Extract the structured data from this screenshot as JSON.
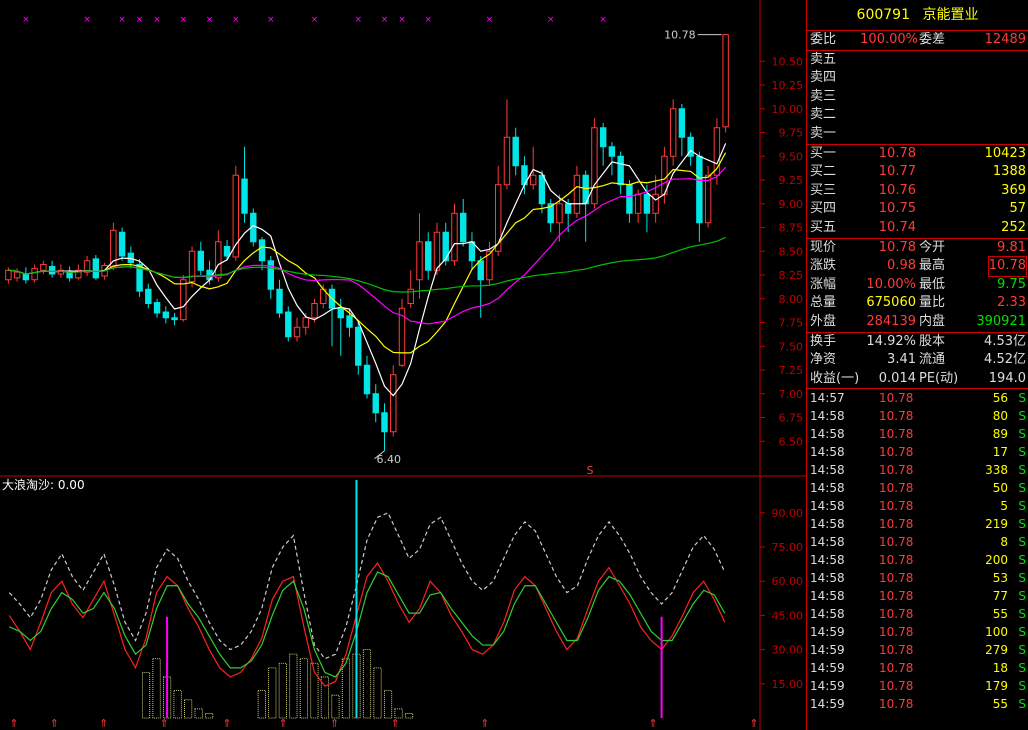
{
  "stock": {
    "code": "600791",
    "name": "京能置业"
  },
  "colors": {
    "up": "#ff3a3a",
    "down": "#00e5e5",
    "ma5": "#ffffff",
    "ma10": "#ffff00",
    "ma20": "#ff00ff",
    "ma60": "#00c000",
    "grid": "#c00000"
  },
  "order_book": {
    "ratio_label": "委比",
    "ratio_value": "100.00%",
    "diff_label": "委差",
    "diff_value": "12489",
    "asks": [
      {
        "label": "卖五",
        "price": "",
        "vol": ""
      },
      {
        "label": "卖四",
        "price": "",
        "vol": ""
      },
      {
        "label": "卖三",
        "price": "",
        "vol": ""
      },
      {
        "label": "卖二",
        "price": "",
        "vol": ""
      },
      {
        "label": "卖一",
        "price": "",
        "vol": ""
      }
    ],
    "bids": [
      {
        "label": "买一",
        "price": "10.78",
        "vol": "10423"
      },
      {
        "label": "买二",
        "price": "10.77",
        "vol": "1388"
      },
      {
        "label": "买三",
        "price": "10.76",
        "vol": "369"
      },
      {
        "label": "买四",
        "price": "10.75",
        "vol": "57"
      },
      {
        "label": "买五",
        "price": "10.74",
        "vol": "252"
      }
    ]
  },
  "quote": [
    {
      "l1": "现价",
      "v1": "10.78",
      "l2": "今开",
      "v2": "9.81"
    },
    {
      "l1": "涨跌",
      "v1": "0.98",
      "l2": "最高",
      "v2": "10.78"
    },
    {
      "l1": "涨幅",
      "v1": "10.00%",
      "l2": "最低",
      "v2": "9.75"
    },
    {
      "l1": "总量",
      "v1": "675060",
      "l2": "量比",
      "v2": "2.33"
    },
    {
      "l1": "外盘",
      "v1": "284139",
      "l2": "内盘",
      "v2": "390921"
    }
  ],
  "fundamentals": [
    {
      "l1": "换手",
      "v1": "14.92%",
      "l2": "股本",
      "v2": "4.53亿"
    },
    {
      "l1": "净资",
      "v1": "3.41",
      "l2": "流通",
      "v2": "4.52亿"
    },
    {
      "l1": "收益(一)",
      "v1": "0.014",
      "l2": "PE(动)",
      "v2": "194.0"
    }
  ],
  "ticks": [
    {
      "time": "14:57",
      "price": "10.78",
      "vol": "56",
      "flag": "S"
    },
    {
      "time": "14:58",
      "price": "10.78",
      "vol": "80",
      "flag": "S"
    },
    {
      "time": "14:58",
      "price": "10.78",
      "vol": "89",
      "flag": "S"
    },
    {
      "time": "14:58",
      "price": "10.78",
      "vol": "17",
      "flag": "S"
    },
    {
      "time": "14:58",
      "price": "10.78",
      "vol": "338",
      "flag": "S"
    },
    {
      "time": "14:58",
      "price": "10.78",
      "vol": "50",
      "flag": "S"
    },
    {
      "time": "14:58",
      "price": "10.78",
      "vol": "5",
      "flag": "S"
    },
    {
      "time": "14:58",
      "price": "10.78",
      "vol": "219",
      "flag": "S"
    },
    {
      "time": "14:58",
      "price": "10.78",
      "vol": "8",
      "flag": "S"
    },
    {
      "time": "14:58",
      "price": "10.78",
      "vol": "200",
      "flag": "S"
    },
    {
      "time": "14:58",
      "price": "10.78",
      "vol": "53",
      "flag": "S"
    },
    {
      "time": "14:58",
      "price": "10.78",
      "vol": "77",
      "flag": "S"
    },
    {
      "time": "14:58",
      "price": "10.78",
      "vol": "55",
      "flag": "S"
    },
    {
      "time": "14:59",
      "price": "10.78",
      "vol": "100",
      "flag": "S"
    },
    {
      "time": "14:59",
      "price": "10.78",
      "vol": "279",
      "flag": "S"
    },
    {
      "time": "14:59",
      "price": "10.78",
      "vol": "18",
      "flag": "S"
    },
    {
      "time": "14:59",
      "price": "10.78",
      "vol": "179",
      "flag": "S"
    },
    {
      "time": "14:59",
      "price": "10.78",
      "vol": "55",
      "flag": "S"
    }
  ],
  "chart_data": [
    {
      "type": "candlestick",
      "y_ticks": [
        "10.50",
        "10.25",
        "10.00",
        "9.75",
        "9.50",
        "9.25",
        "9.00",
        "8.75",
        "8.50",
        "8.25",
        "8.00",
        "7.75",
        "7.50",
        "7.25",
        "7.00",
        "6.75",
        "6.50"
      ],
      "ylim": [
        6.4,
        10.78
      ],
      "annotations": {
        "high_label": "10.78",
        "low_label": "6.40",
        "marker": "S"
      },
      "candles": [
        [
          8.2,
          8.3,
          8.33,
          8.16
        ],
        [
          8.22,
          8.28,
          8.32,
          8.18
        ],
        [
          8.26,
          8.2,
          8.33,
          8.16
        ],
        [
          8.2,
          8.32,
          8.36,
          8.17
        ],
        [
          8.3,
          8.36,
          8.4,
          8.26
        ],
        [
          8.34,
          8.26,
          8.4,
          8.22
        ],
        [
          8.26,
          8.3,
          8.36,
          8.22
        ],
        [
          8.28,
          8.22,
          8.34,
          8.18
        ],
        [
          8.22,
          8.3,
          8.36,
          8.2
        ],
        [
          8.28,
          8.4,
          8.45,
          8.24
        ],
        [
          8.42,
          8.22,
          8.46,
          8.2
        ],
        [
          8.24,
          8.35,
          8.38,
          8.2
        ],
        [
          8.34,
          8.72,
          8.8,
          8.3
        ],
        [
          8.7,
          8.45,
          8.75,
          8.4
        ],
        [
          8.48,
          8.38,
          8.55,
          8.32
        ],
        [
          8.36,
          8.08,
          8.42,
          8.02
        ],
        [
          8.1,
          7.95,
          8.16,
          7.9
        ],
        [
          7.96,
          7.85,
          8.0,
          7.8
        ],
        [
          7.86,
          7.8,
          7.92,
          7.74
        ],
        [
          7.8,
          7.78,
          7.85,
          7.72
        ],
        [
          7.78,
          8.2,
          8.25,
          7.76
        ],
        [
          8.18,
          8.5,
          8.55,
          8.12
        ],
        [
          8.5,
          8.3,
          8.6,
          8.25
        ],
        [
          8.3,
          8.2,
          8.4,
          8.15
        ],
        [
          8.22,
          8.6,
          8.72,
          8.18
        ],
        [
          8.55,
          8.45,
          8.62,
          8.4
        ],
        [
          8.44,
          9.3,
          9.4,
          8.4
        ],
        [
          9.26,
          8.9,
          9.6,
          8.8
        ],
        [
          8.9,
          8.6,
          8.95,
          8.55
        ],
        [
          8.62,
          8.4,
          8.65,
          8.3
        ],
        [
          8.4,
          8.1,
          8.45,
          8.0
        ],
        [
          8.1,
          7.85,
          8.2,
          7.8
        ],
        [
          7.86,
          7.6,
          7.92,
          7.55
        ],
        [
          7.6,
          7.7,
          7.8,
          7.55
        ],
        [
          7.7,
          7.8,
          7.85,
          7.62
        ],
        [
          7.8,
          7.95,
          8.0,
          7.75
        ],
        [
          7.95,
          8.1,
          8.15,
          7.9
        ],
        [
          8.1,
          7.9,
          8.15,
          7.5
        ],
        [
          7.9,
          7.8,
          8.0,
          7.4
        ],
        [
          7.82,
          7.7,
          7.9,
          7.6
        ],
        [
          7.7,
          7.3,
          7.76,
          7.2
        ],
        [
          7.3,
          7.0,
          7.4,
          6.95
        ],
        [
          7.0,
          6.8,
          7.1,
          6.7
        ],
        [
          6.8,
          6.6,
          6.9,
          6.4
        ],
        [
          6.6,
          7.2,
          7.3,
          6.55
        ],
        [
          7.3,
          7.9,
          8.0,
          7.28
        ],
        [
          7.95,
          8.1,
          8.3,
          7.9
        ],
        [
          8.2,
          8.6,
          8.9,
          8.0
        ],
        [
          8.6,
          8.3,
          8.7,
          8.2
        ],
        [
          8.3,
          8.7,
          8.8,
          8.25
        ],
        [
          8.7,
          8.4,
          8.8,
          8.35
        ],
        [
          8.4,
          8.9,
          9.0,
          8.35
        ],
        [
          8.9,
          8.6,
          9.05,
          8.55
        ],
        [
          8.6,
          8.4,
          8.7,
          8.3
        ],
        [
          8.4,
          8.2,
          8.45,
          7.8
        ],
        [
          8.2,
          8.5,
          8.6,
          8.15
        ],
        [
          8.5,
          9.2,
          9.4,
          8.45
        ],
        [
          9.2,
          9.7,
          10.1,
          9.15
        ],
        [
          9.7,
          9.4,
          9.8,
          9.3
        ],
        [
          9.4,
          9.2,
          9.5,
          9.1
        ],
        [
          9.2,
          9.3,
          9.6,
          9.15
        ],
        [
          9.3,
          9.0,
          9.35,
          8.9
        ],
        [
          9.0,
          8.8,
          9.05,
          8.7
        ],
        [
          8.8,
          9.0,
          9.1,
          8.6
        ],
        [
          9.0,
          8.9,
          9.05,
          8.7
        ],
        [
          8.9,
          9.3,
          9.4,
          8.85
        ],
        [
          9.3,
          9.0,
          9.35,
          8.6
        ],
        [
          9.0,
          9.8,
          9.9,
          8.95
        ],
        [
          9.8,
          9.6,
          9.85,
          9.4
        ],
        [
          9.6,
          9.5,
          9.65,
          9.3
        ],
        [
          9.5,
          9.2,
          9.55,
          9.1
        ],
        [
          9.2,
          8.9,
          9.25,
          8.8
        ],
        [
          8.9,
          9.1,
          9.15,
          8.8
        ],
        [
          9.1,
          8.9,
          9.2,
          8.7
        ],
        [
          8.9,
          9.1,
          9.3,
          8.8
        ],
        [
          9.1,
          9.5,
          9.6,
          9.0
        ],
        [
          9.5,
          10.0,
          10.1,
          9.4
        ],
        [
          10.0,
          9.7,
          10.05,
          9.5
        ],
        [
          9.7,
          9.5,
          9.75,
          9.4
        ],
        [
          9.5,
          8.8,
          9.55,
          8.6
        ],
        [
          8.8,
          9.3,
          9.4,
          8.75
        ],
        [
          9.3,
          9.8,
          9.9,
          9.2
        ],
        [
          9.81,
          10.78,
          10.78,
          9.75
        ]
      ]
    },
    {
      "type": "line",
      "title": "大浪淘沙: 0.00",
      "y_ticks": [
        "90.00",
        "75.00",
        "60.00",
        "45.00",
        "30.00",
        "15.00"
      ],
      "ylim": [
        0,
        100
      ],
      "series": [
        {
          "name": "red",
          "values": [
            45,
            38,
            30,
            42,
            55,
            60,
            50,
            44,
            52,
            60,
            45,
            30,
            22,
            35,
            55,
            62,
            58,
            48,
            40,
            30,
            22,
            18,
            20,
            26,
            35,
            52,
            60,
            62,
            40,
            20,
            14,
            16,
            28,
            45,
            62,
            68,
            60,
            50,
            42,
            48,
            60,
            55,
            45,
            38,
            30,
            28,
            32,
            42,
            56,
            62,
            58,
            48,
            38,
            30,
            35,
            48,
            60,
            66,
            58,
            50,
            40,
            34,
            30,
            36,
            45,
            55,
            60,
            52,
            42
          ]
        },
        {
          "name": "green",
          "values": [
            40,
            38,
            34,
            38,
            48,
            55,
            52,
            46,
            48,
            55,
            48,
            36,
            28,
            32,
            48,
            58,
            58,
            50,
            44,
            36,
            28,
            22,
            22,
            25,
            32,
            45,
            56,
            60,
            48,
            30,
            20,
            18,
            24,
            38,
            55,
            64,
            62,
            54,
            46,
            46,
            54,
            55,
            48,
            42,
            36,
            32,
            32,
            38,
            50,
            58,
            58,
            50,
            42,
            34,
            34,
            44,
            56,
            62,
            60,
            54,
            46,
            38,
            34,
            34,
            42,
            50,
            56,
            54,
            46
          ]
        },
        {
          "name": "white-dashed",
          "values": [
            55,
            50,
            44,
            52,
            65,
            72,
            62,
            56,
            64,
            72,
            58,
            42,
            34,
            46,
            66,
            74,
            70,
            60,
            52,
            42,
            34,
            30,
            32,
            38,
            48,
            66,
            75,
            80,
            55,
            32,
            26,
            28,
            40,
            58,
            78,
            88,
            90,
            80,
            70,
            74,
            85,
            88,
            78,
            68,
            60,
            56,
            60,
            70,
            80,
            86,
            82,
            72,
            62,
            55,
            58,
            70,
            80,
            86,
            80,
            72,
            62,
            55,
            50,
            55,
            65,
            75,
            80,
            74,
            64
          ]
        }
      ],
      "bars_white": [
        0,
        0,
        0,
        0,
        0,
        0,
        0,
        0,
        0,
        0,
        0,
        0,
        0,
        20,
        26,
        18,
        12,
        8,
        4,
        2,
        0,
        0,
        0,
        0,
        12,
        22,
        24,
        28,
        26,
        24,
        18,
        10,
        26,
        28,
        30,
        22,
        12,
        4,
        2,
        0,
        0,
        0,
        0,
        0,
        0,
        0,
        0,
        0,
        0,
        0,
        0,
        0,
        0,
        0,
        0,
        0,
        0,
        0,
        0,
        0,
        0,
        0,
        0,
        0,
        0,
        0,
        0,
        0,
        0
      ],
      "spikes": [
        {
          "index": 15,
          "value": 40,
          "color": "#ff00ff"
        },
        {
          "index": 33,
          "value": 100,
          "color": "#00e5e5"
        },
        {
          "index": 62,
          "value": 40,
          "color": "#ff00ff"
        }
      ]
    }
  ]
}
